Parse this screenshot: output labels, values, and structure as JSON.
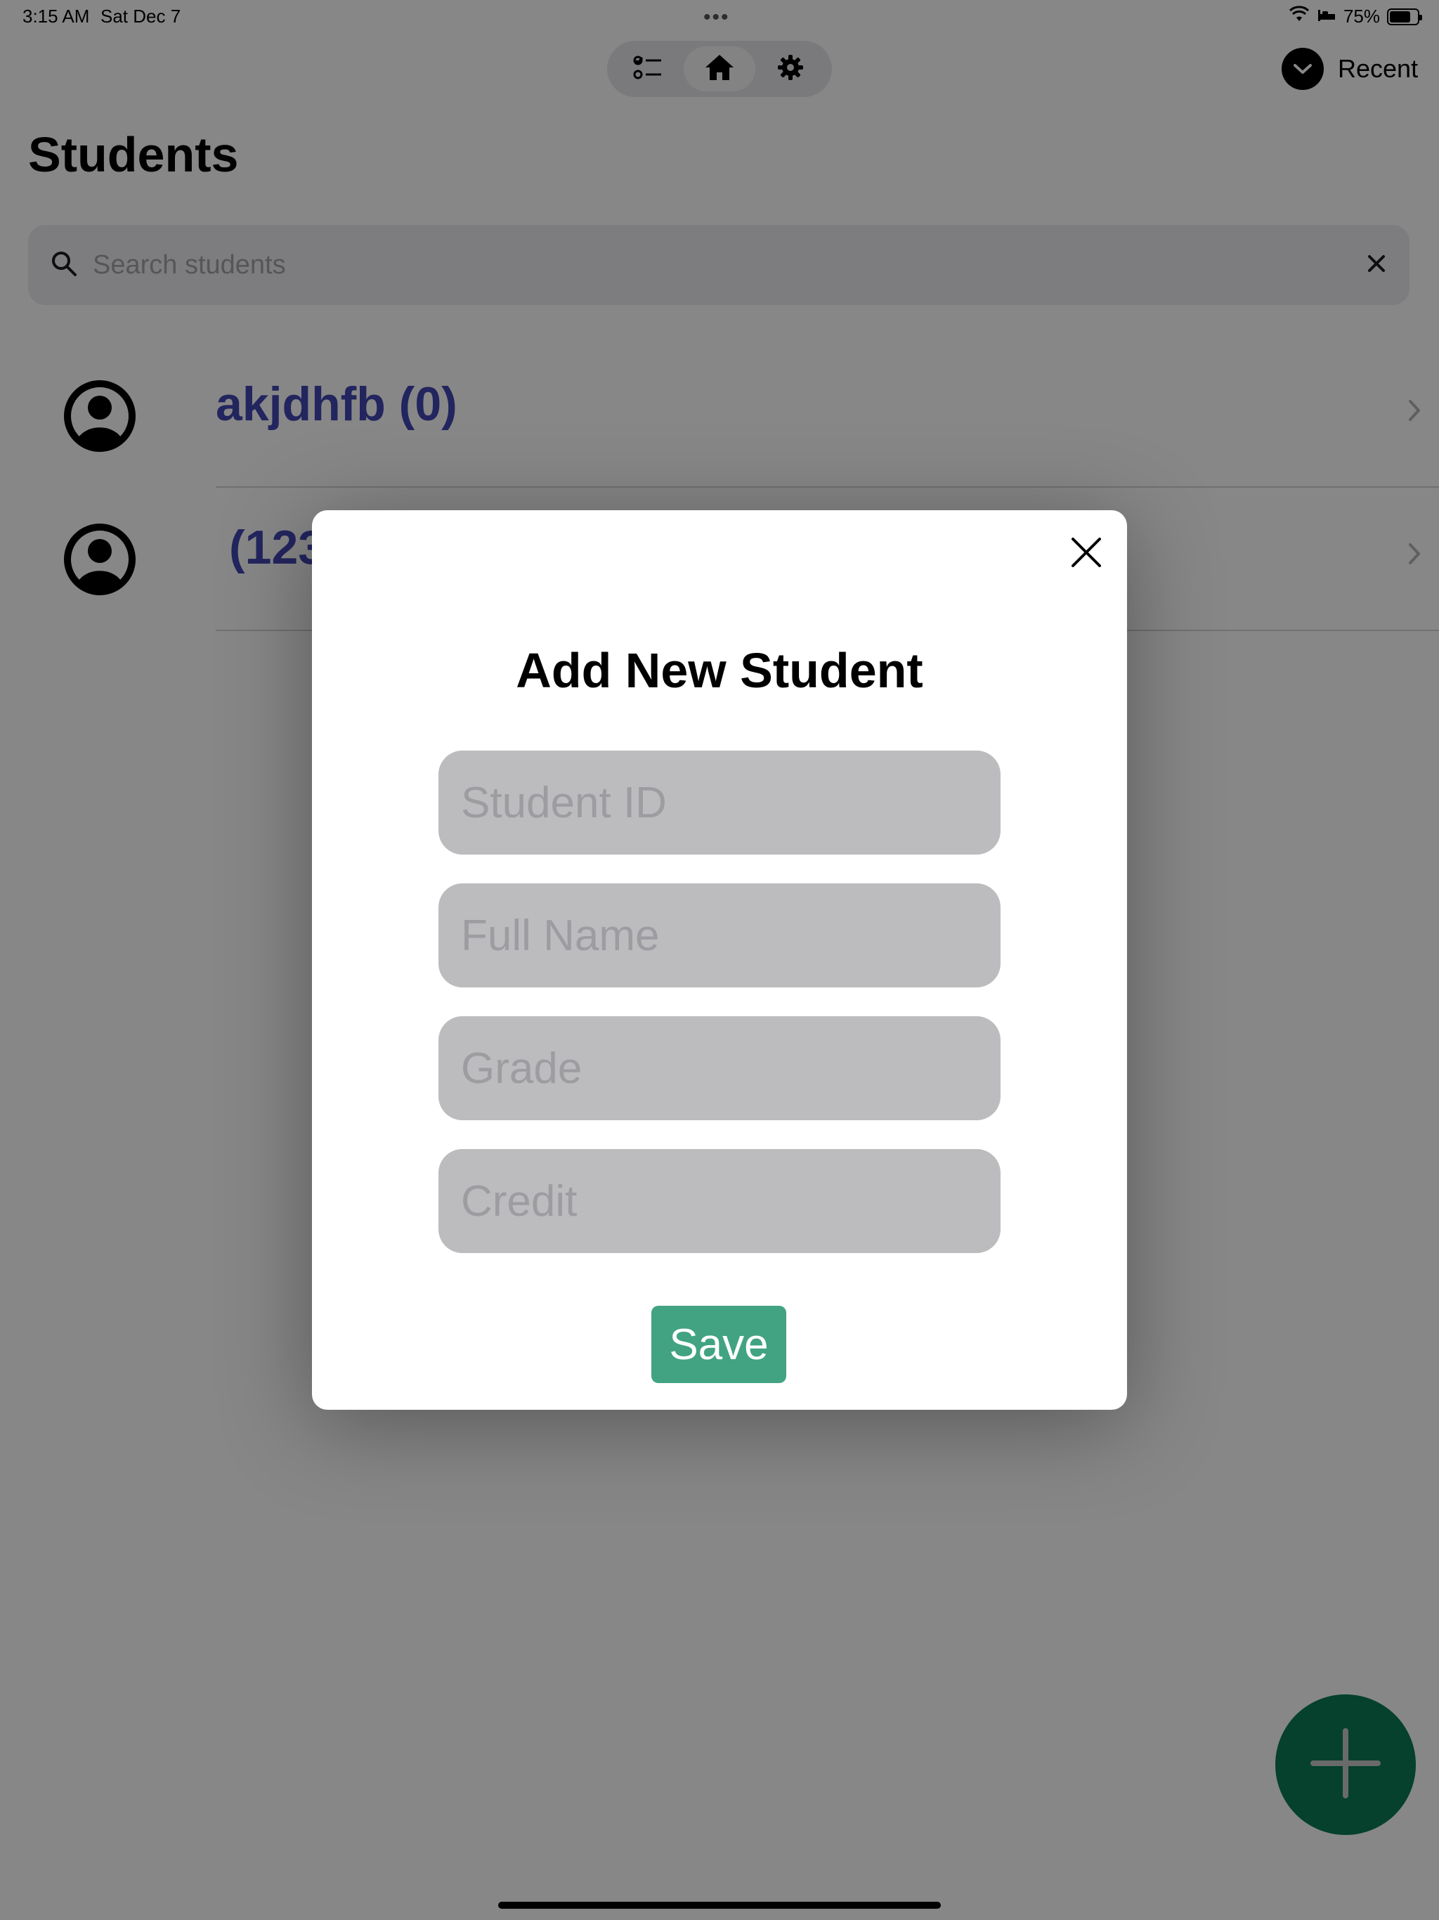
{
  "status_bar": {
    "time": "3:15 AM",
    "date": "Sat Dec 7",
    "dots": "•••",
    "battery_percent": "75%",
    "battery_level": 0.75
  },
  "toolbar": {
    "buttons": [
      {
        "icon": "checklist-icon",
        "active": false
      },
      {
        "icon": "house-icon",
        "active": true
      },
      {
        "icon": "gear-icon",
        "active": false
      }
    ]
  },
  "recent": {
    "label": "Recent",
    "icon": "chevron-down-icon"
  },
  "page": {
    "title": "Students"
  },
  "search": {
    "placeholder": "Search students"
  },
  "students": [
    {
      "label": "akjdhfb (0)"
    },
    {
      "label": "(123"
    }
  ],
  "modal": {
    "title": "Add New Student",
    "fields": [
      {
        "placeholder": "Student ID"
      },
      {
        "placeholder": "Full Name"
      },
      {
        "placeholder": "Grade"
      },
      {
        "placeholder": "Credit"
      }
    ],
    "save_label": "Save"
  },
  "colors": {
    "accent_text": "#4347b4",
    "fab": "#0a7c54",
    "save_button": "#41a382",
    "overlay": "rgba(0,0,0,0.47)"
  }
}
